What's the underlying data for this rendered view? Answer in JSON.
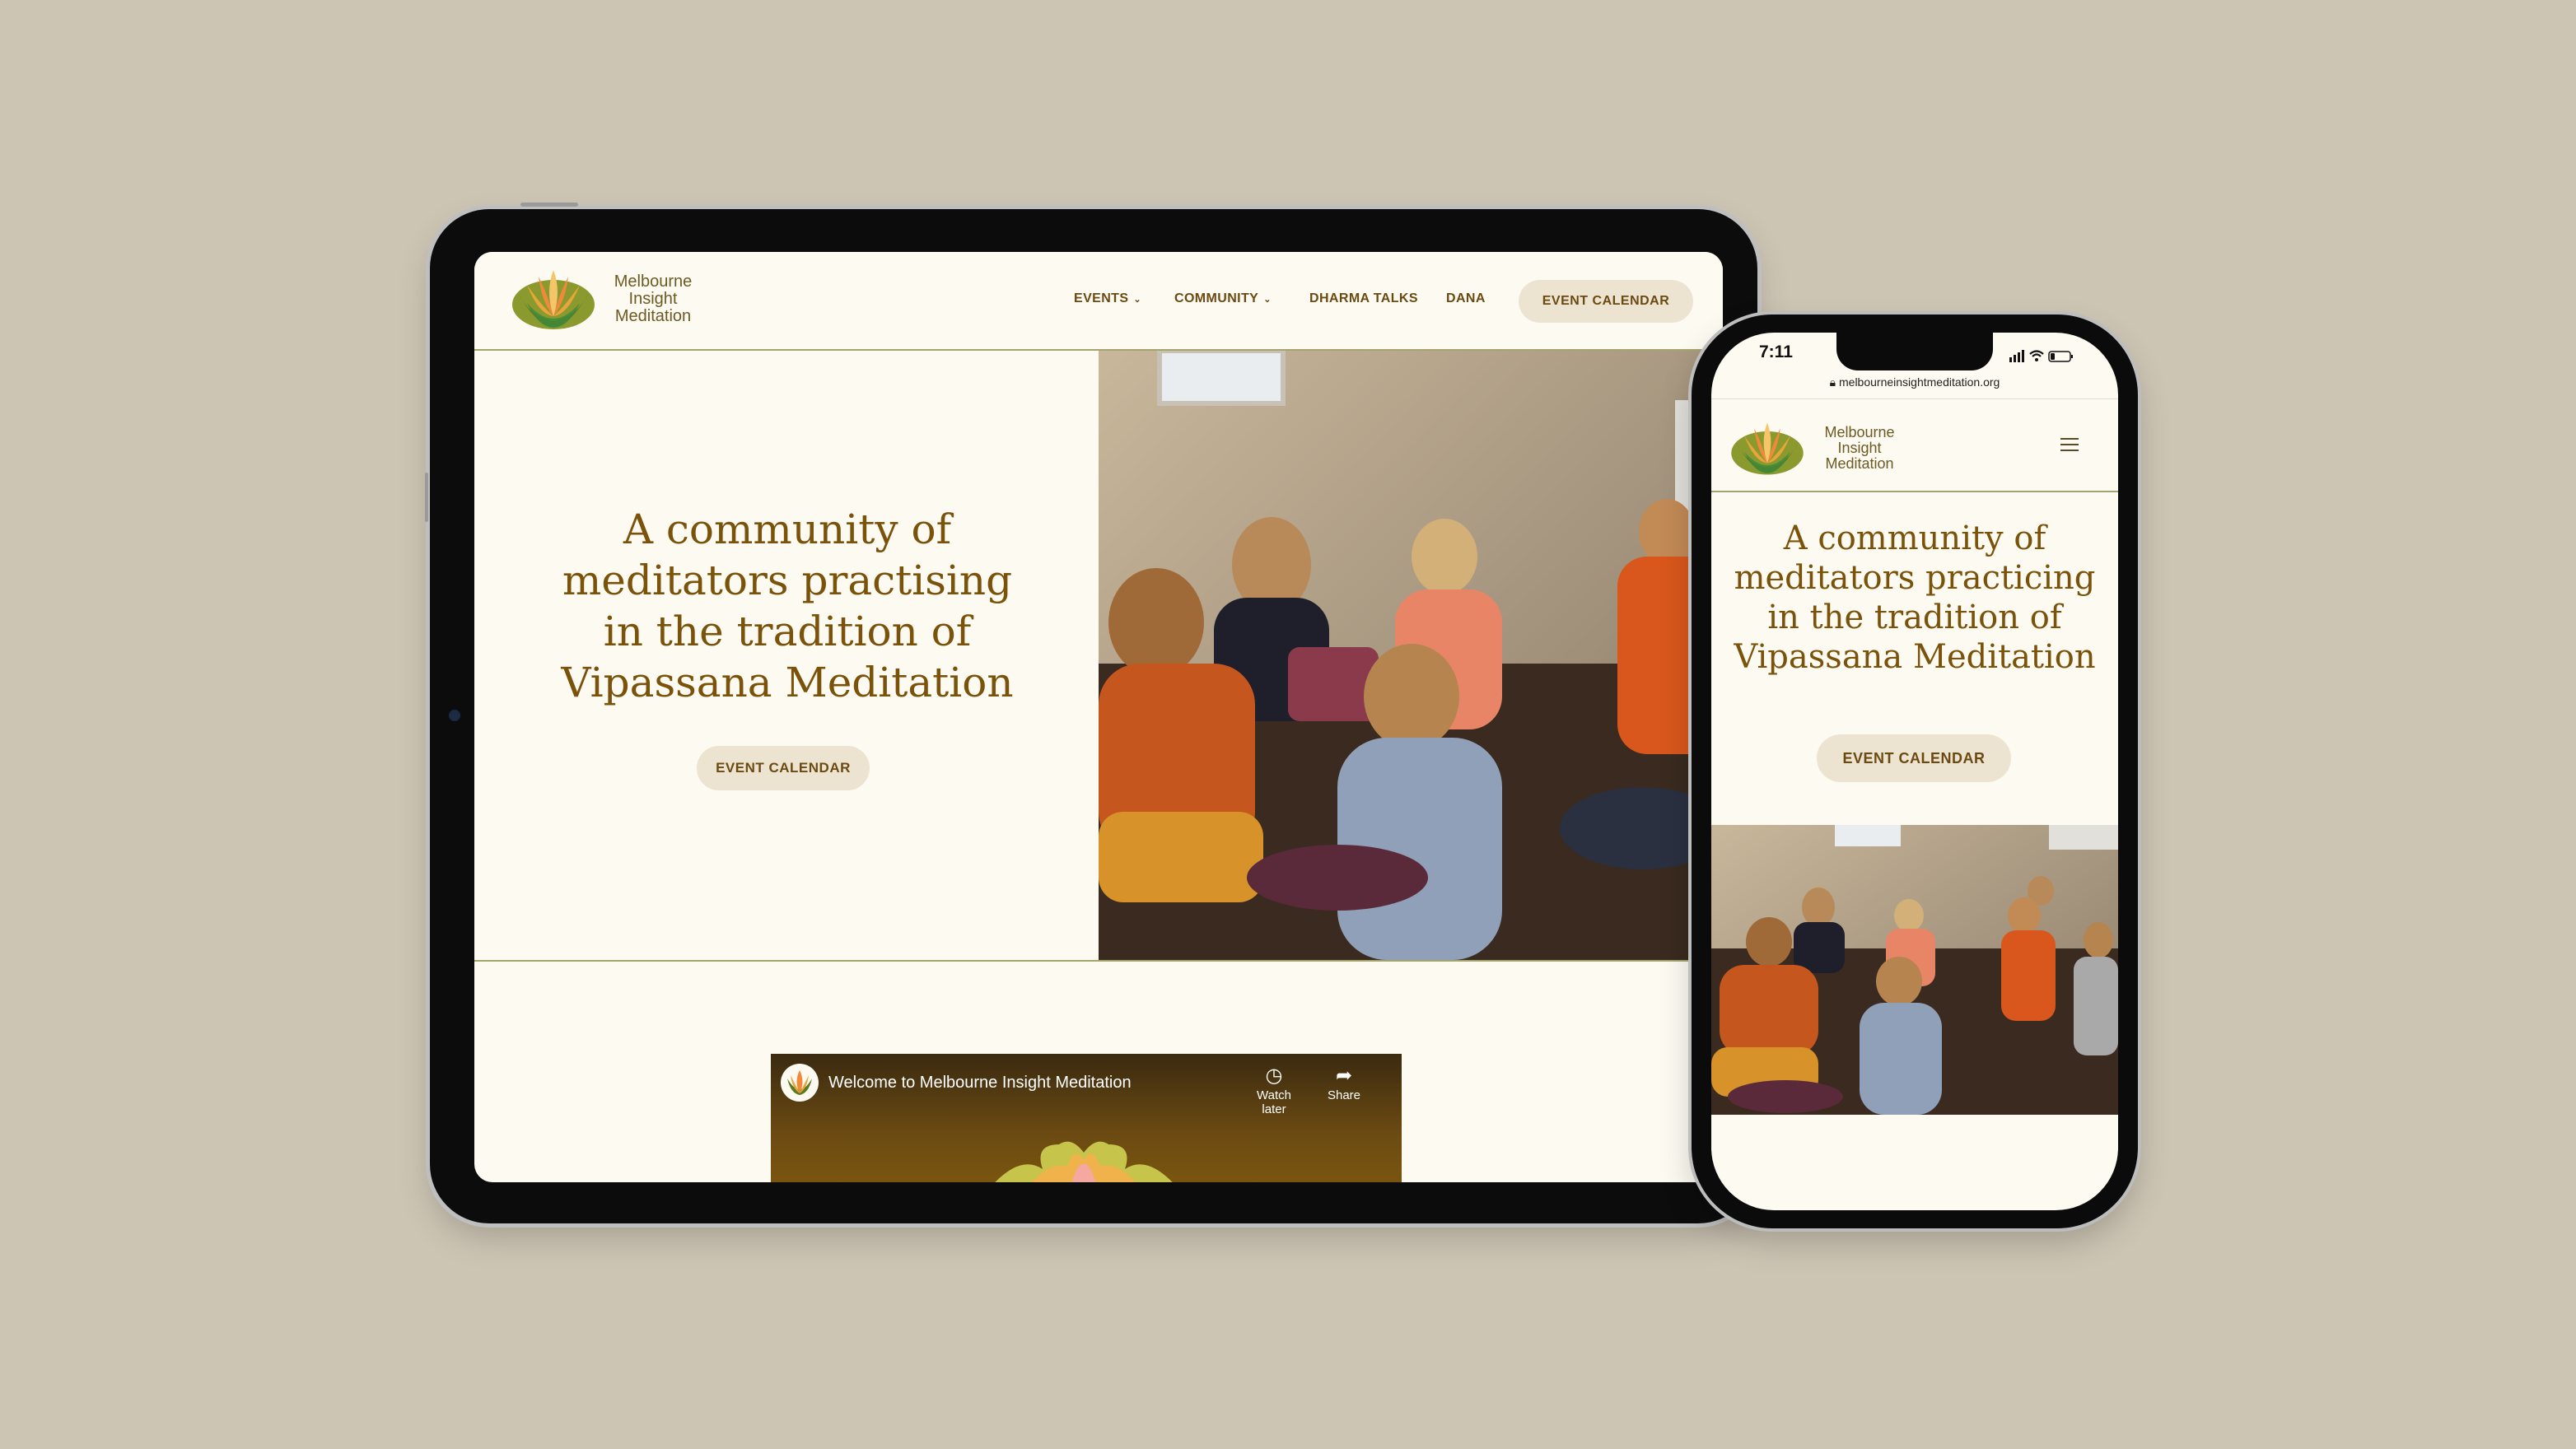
{
  "colors": {
    "background": "#cdc5b4",
    "page": "#fdfaf2",
    "accent_text": "#7a5209",
    "nav_text": "#6b4a12",
    "button_bg": "#ede3d1",
    "divider": "#a3a46e"
  },
  "brand": {
    "line1": "Melbourne",
    "line2": "Insight",
    "line3": "Meditation",
    "logo_icon": "lotus-icon"
  },
  "nav": {
    "items": [
      {
        "label": "EVENTS",
        "dropdown": true
      },
      {
        "label": "COMMUNITY",
        "dropdown": true
      },
      {
        "label": "DHARMA TALKS",
        "dropdown": false
      },
      {
        "label": "DANA",
        "dropdown": false
      }
    ],
    "cta": "EVENT CALENDAR"
  },
  "hero": {
    "tablet_title": [
      "A community of",
      "meditators practising",
      "in the tradition of",
      "Vipassana Meditation"
    ],
    "phone_title": [
      "A community of",
      "meditators practicing",
      "in the tradition of",
      "Vipassana Meditation"
    ],
    "button": "EVENT CALENDAR"
  },
  "video": {
    "title": "Welcome to Melbourne Insight Meditation",
    "watch_later": "Watch later",
    "share": "Share"
  },
  "phone": {
    "time": "7:11",
    "url": "melbourneinsightmeditation.org",
    "menu_icon": "hamburger-icon"
  }
}
